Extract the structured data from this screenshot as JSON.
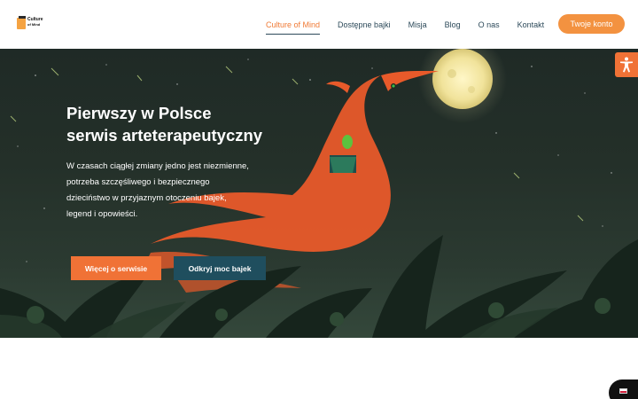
{
  "brand": {
    "logo_line1": "Culture",
    "logo_line2": "of Mind"
  },
  "nav": {
    "items": [
      {
        "label": "Culture of Mind",
        "active": true
      },
      {
        "label": "Dostępne bajki"
      },
      {
        "label": "Misja"
      },
      {
        "label": "Blog"
      },
      {
        "label": "O nas"
      },
      {
        "label": "Kontakt"
      }
    ]
  },
  "header": {
    "account_label": "Twoje konto"
  },
  "hero": {
    "title_line1": "Pierwszy w Polsce",
    "title_line2": "serwis arteterapeutyczny",
    "text_lines": [
      "W czasach ciągłej zmiany jedno jest niezmienne,",
      "potrzeba szczęśliwego i bezpiecznego",
      "dzieciństwo w przyjaznym otoczeniu bajek,",
      "legend i opowieści."
    ],
    "btn_more": "Więcej o serwisie",
    "btn_discover": "Odkryj moc bajek"
  },
  "colors": {
    "accent": "#f07236",
    "nav_text": "#2d4a5a",
    "secondary_button": "#1f4e5e"
  },
  "icons": {
    "accessibility": "accessibility-icon",
    "language": "polish-flag-icon"
  }
}
